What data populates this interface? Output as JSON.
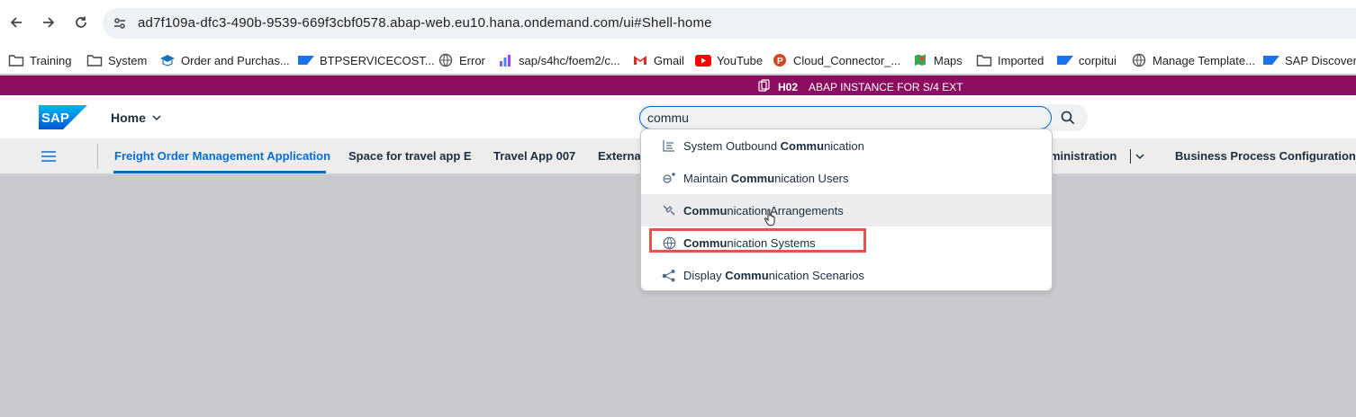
{
  "browser": {
    "url": "ad7f109a-dfc3-490b-9539-669f3cbf0578.abap-web.eu10.hana.ondemand.com/ui#Shell-home",
    "bookmarks": [
      {
        "label": "Training",
        "icon": "folder-icon"
      },
      {
        "label": "System",
        "icon": "folder-icon"
      },
      {
        "label": "Order and Purchas...",
        "icon": "sap-academy-icon"
      },
      {
        "label": "BTPSERVICECOST...",
        "icon": "sap-logo-icon"
      },
      {
        "label": "Error",
        "icon": "globe-icon"
      },
      {
        "label": "sap/s4hc/foem2/c...",
        "icon": "chart-icon"
      },
      {
        "label": "Gmail",
        "icon": "gmail-icon"
      },
      {
        "label": "YouTube",
        "icon": "youtube-icon"
      },
      {
        "label": "Cloud_Connector_...",
        "icon": "powerpoint-icon"
      },
      {
        "label": "Maps",
        "icon": "maps-icon"
      },
      {
        "label": "Imported",
        "icon": "folder-icon"
      },
      {
        "label": "corpitui",
        "icon": "sap-logo-icon"
      },
      {
        "label": "Manage Template...",
        "icon": "globe-icon"
      },
      {
        "label": "SAP Discovery",
        "icon": "sap-logo-icon"
      }
    ]
  },
  "system_bar": {
    "system_id": "H02",
    "description": "ABAP INSTANCE FOR S/4 EXT"
  },
  "shell": {
    "logo_text": "SAP",
    "home_label": "Home",
    "search_value": "commu"
  },
  "spaces": {
    "tabs": [
      {
        "label": "Freight Order Management Application",
        "active": true
      },
      {
        "label": "Space for travel app E"
      },
      {
        "label": "Travel App 007"
      },
      {
        "label": "External"
      },
      {
        "label": "dministration"
      },
      {
        "label": "Business Process Configuration"
      }
    ]
  },
  "suggestions": [
    {
      "prefix": "System Outbound ",
      "match": "Commu",
      "suffix": "nication",
      "icon": "list-icon"
    },
    {
      "prefix": "Maintain ",
      "match": "Commu",
      "suffix": "nication Users",
      "icon": "user-settings-icon"
    },
    {
      "prefix": "",
      "match": "Commu",
      "suffix": "nication Arrangements",
      "icon": "connection-icon"
    },
    {
      "prefix": "",
      "match": "Commu",
      "suffix": "nication Systems",
      "icon": "globe-icon"
    },
    {
      "prefix": "Display ",
      "match": "Commu",
      "suffix": "nication Scenarios",
      "icon": "share-nodes-icon"
    }
  ],
  "colors": {
    "system_bar": "#8c0d5f",
    "accent": "#0a6ed1",
    "highlight_box": "#e5534b",
    "canvas": "#c9cacd"
  }
}
